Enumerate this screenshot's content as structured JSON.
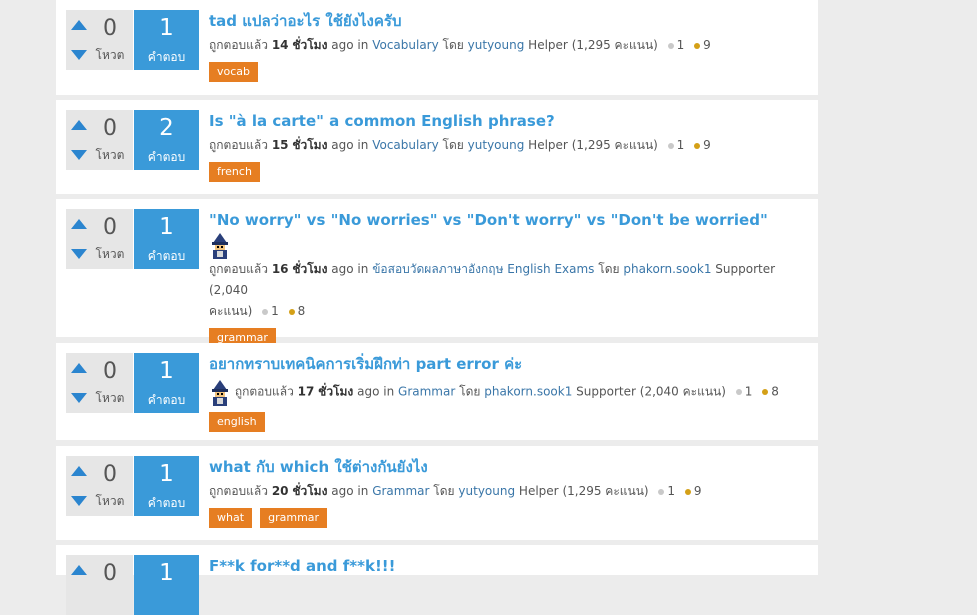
{
  "labels": {
    "votes": "โหวต",
    "answers": "คำตอบ",
    "answered_prefix": "ถูกตอบแล้ว",
    "hours": "ชั่วโมง",
    "ago": "ago",
    "in": "in",
    "by": "โดย"
  },
  "questions": [
    {
      "votes": "0",
      "answers": "1",
      "title": "tad แปลว่าอะไร ใช้ยังไงครับ",
      "hours_ago": "14",
      "category": "Vocabulary",
      "user": "yutyoung",
      "role": "Helper",
      "points": "(1,295 คะแนน)",
      "silver": "1",
      "gold": "9",
      "tags": [
        "vocab"
      ]
    },
    {
      "votes": "0",
      "answers": "2",
      "title": "Is \"à la carte\" a common English phrase?",
      "hours_ago": "15",
      "category": "Vocabulary",
      "user": "yutyoung",
      "role": "Helper",
      "points": "(1,295 คะแนน)",
      "silver": "1",
      "gold": "9",
      "tags": [
        "french"
      ]
    },
    {
      "votes": "0",
      "answers": "1",
      "title": "\"No worry\" vs \"No worries\" vs \"Don't worry\" vs \"Don't be worried\"",
      "hours_ago": "16",
      "category": "ข้อสอบวัดผลภาษาอังกฤษ English Exams",
      "user": "phakorn.sook1",
      "role": "Supporter",
      "points_a": "(2,040",
      "points_b": "คะแนน)",
      "silver": "1",
      "gold": "8",
      "tags": [
        "grammar"
      ]
    },
    {
      "votes": "0",
      "answers": "1",
      "title": "อยากทราบเทคนิคการเริ่มฝึกท่า part error ค่ะ",
      "hours_ago": "17",
      "category": "Grammar",
      "user": "phakorn.sook1",
      "role": "Supporter",
      "points": "(2,040 คะแนน)",
      "silver": "1",
      "gold": "8",
      "tags": [
        "english"
      ]
    },
    {
      "votes": "0",
      "answers": "1",
      "title": "what กับ which ใช้ต่างกันยังไง",
      "hours_ago": "20",
      "category": "Grammar",
      "user": "yutyoung",
      "role": "Helper",
      "points": "(1,295 คะแนน)",
      "silver": "1",
      "gold": "9",
      "tags": [
        "what",
        "grammar"
      ]
    },
    {
      "votes": "0",
      "answers": "1",
      "title": "F**k for**d and f**k!!!"
    }
  ]
}
